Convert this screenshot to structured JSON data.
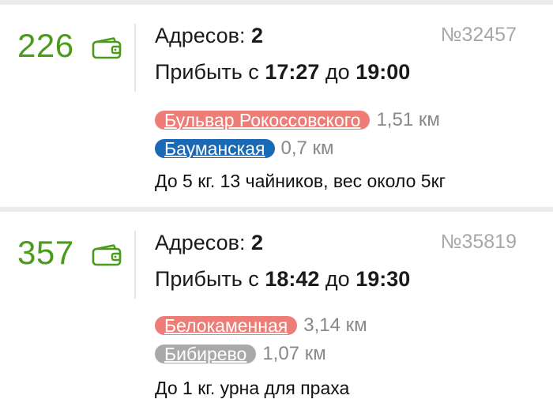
{
  "orders": [
    {
      "price": "226",
      "addresses_label": "Адресов:",
      "addresses_count": "2",
      "number": "№32457",
      "arrive_prefix": "Прибыть с",
      "arrive_from": "17:27",
      "arrive_mid": "до",
      "arrive_to": "19:00",
      "metros": [
        {
          "name": "Бульвар Рокоссовского",
          "distance": "1,51 км",
          "color": "#ef7d77"
        },
        {
          "name": "Бауманская",
          "distance": "0,7 км",
          "color": "#1a69b5"
        }
      ],
      "description": "До 5 кг. 13 чайников, вес около 5кг"
    },
    {
      "price": "357",
      "addresses_label": "Адресов:",
      "addresses_count": "2",
      "number": "№35819",
      "arrive_prefix": "Прибыть с",
      "arrive_from": "18:42",
      "arrive_mid": "до",
      "arrive_to": "19:30",
      "metros": [
        {
          "name": "Белокаменная",
          "distance": "3,14 км",
          "color": "#ef7d77"
        },
        {
          "name": "Бибирево",
          "distance": "1,07 км",
          "color": "#a9a9a9"
        }
      ],
      "description": "До 1 кг. урна для праха"
    }
  ],
  "icons": {
    "wallet": "wallet-icon"
  },
  "colors": {
    "price": "#4a9b1b",
    "muted": "#a8a8a8",
    "divider": "#ececec"
  }
}
